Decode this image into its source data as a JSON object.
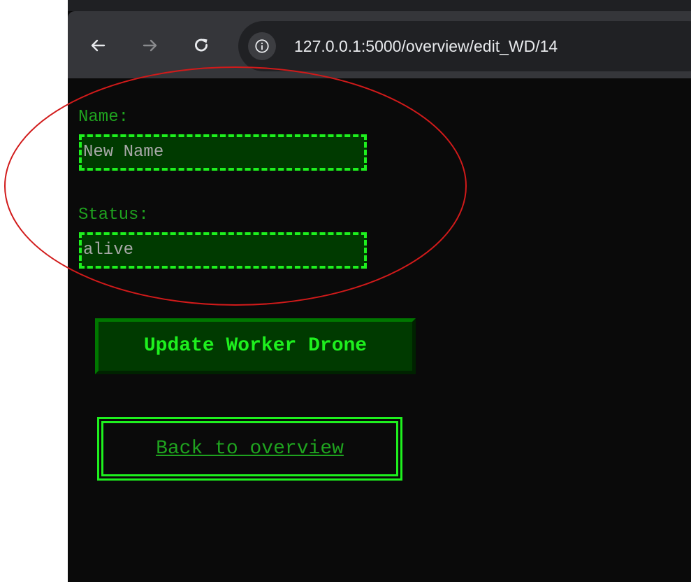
{
  "browser": {
    "url": "127.0.0.1:5000/overview/edit_WD/14",
    "icons": {
      "back": "arrow-left-icon",
      "forward": "arrow-right-icon",
      "reload": "reload-icon",
      "site_info": "info-circle-icon"
    }
  },
  "form": {
    "name_label": "Name:",
    "name_value": "New Name",
    "status_label": "Status:",
    "status_value": "alive",
    "submit_label": "Update Worker Drone"
  },
  "back_link": {
    "label": "Back to overview"
  },
  "colors": {
    "page_background": "#0a0a0a",
    "accent_green": "#1ef01e",
    "label_green": "#1fa31f",
    "input_background": "#003a00",
    "annotation_red": "#d11a1a"
  }
}
